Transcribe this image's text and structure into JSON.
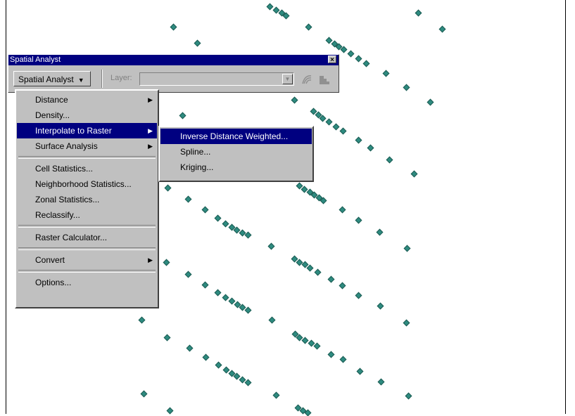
{
  "toolbar": {
    "title": "Spatial Analyst",
    "close_glyph": "×",
    "dropdown_label": "Spatial Analyst",
    "dropdown_arrow": "▼",
    "layer_label": "Layer:",
    "layer_value": "",
    "layer_drop_glyph": "▼",
    "icons": [
      "contour-icon",
      "histogram-icon"
    ]
  },
  "menu": {
    "items": [
      {
        "label": "Distance",
        "has_submenu": true
      },
      {
        "label": "Density..."
      },
      {
        "label": "Interpolate to Raster",
        "has_submenu": true,
        "highlighted": true
      },
      {
        "label": "Surface Analysis",
        "has_submenu": true
      },
      {
        "label": "Cell Statistics..."
      },
      {
        "label": "Neighborhood Statistics..."
      },
      {
        "label": "Zonal Statistics..."
      },
      {
        "label": "Reclassify..."
      },
      {
        "label": "Raster Calculator..."
      },
      {
        "label": "Convert",
        "has_submenu": true
      },
      {
        "label": "Options..."
      }
    ],
    "submenu_glyph": "▶"
  },
  "submenu": {
    "items": [
      {
        "label": "Inverse Distance Weighted...",
        "highlighted": true
      },
      {
        "label": "Spline..."
      },
      {
        "label": "Kriging..."
      }
    ]
  },
  "colors": {
    "title_bar": "#000080",
    "face": "#c0c0c0",
    "highlight": "#000080",
    "point": "#2e8b80"
  }
}
